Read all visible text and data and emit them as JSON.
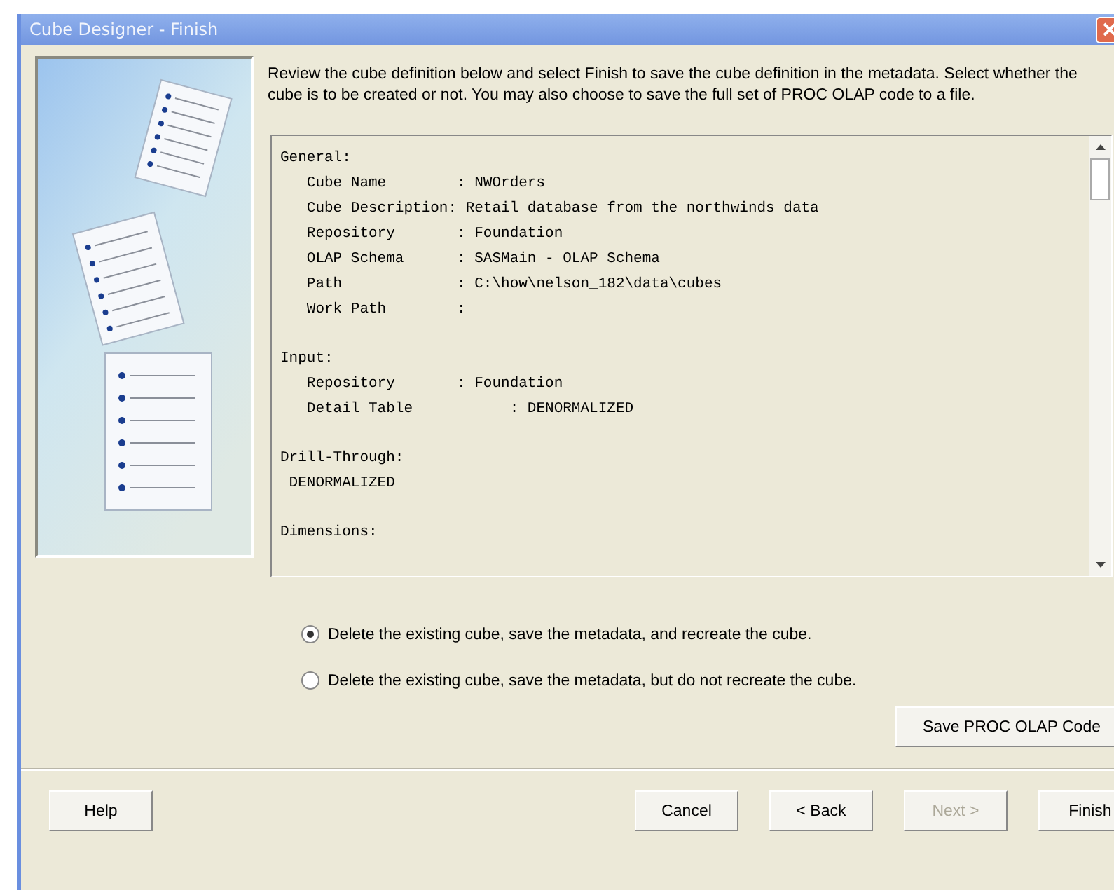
{
  "window": {
    "title": "Cube Designer - Finish"
  },
  "instructions": "Review the cube definition below and select Finish to save the cube definition in the metadata. Select whether the cube is to be created or not. You may also choose to save the full set of PROC OLAP code to a file.",
  "definition": [
    {
      "heading": "General:",
      "lines": [
        "   Cube Name        : NWOrders",
        "   Cube Description: Retail database from the northwinds data",
        "   Repository       : Foundation",
        "   OLAP Schema      : SASMain - OLAP Schema",
        "   Path             : C:\\how\\nelson_182\\data\\cubes",
        "   Work Path        :"
      ]
    },
    {
      "heading": "Input:",
      "lines": [
        "   Repository       : Foundation",
        "   Detail Table           : DENORMALIZED"
      ]
    },
    {
      "heading": "Drill-Through:",
      "lines": [
        " DENORMALIZED"
      ]
    },
    {
      "heading": "Dimensions:"
    }
  ],
  "options": [
    {
      "label": "Delete the existing cube, save the metadata, and recreate the cube.",
      "selected": true
    },
    {
      "label": "Delete the existing cube, save the metadata, but do not recreate the cube.",
      "selected": false
    }
  ],
  "save_button": "Save PROC OLAP Code",
  "buttons": [
    {
      "label": "Help",
      "disabled": false
    },
    {
      "label": "Cancel",
      "disabled": false
    },
    {
      "label": "< Back",
      "disabled": false
    },
    {
      "label": "Next >",
      "disabled": true
    },
    {
      "label": "Finish",
      "disabled": false
    }
  ]
}
